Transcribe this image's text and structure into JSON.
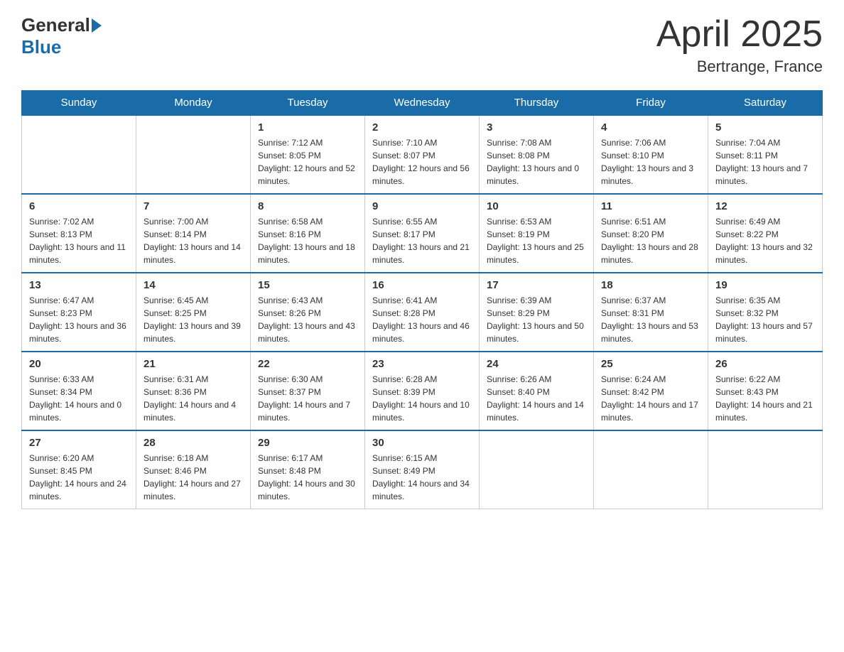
{
  "header": {
    "logo": {
      "general": "General",
      "blue": "Blue"
    },
    "title": "April 2025",
    "subtitle": "Bertrange, France"
  },
  "weekdays": [
    "Sunday",
    "Monday",
    "Tuesday",
    "Wednesday",
    "Thursday",
    "Friday",
    "Saturday"
  ],
  "weeks": [
    [
      {
        "day": "",
        "sunrise": "",
        "sunset": "",
        "daylight": ""
      },
      {
        "day": "",
        "sunrise": "",
        "sunset": "",
        "daylight": ""
      },
      {
        "day": "1",
        "sunrise": "Sunrise: 7:12 AM",
        "sunset": "Sunset: 8:05 PM",
        "daylight": "Daylight: 12 hours and 52 minutes."
      },
      {
        "day": "2",
        "sunrise": "Sunrise: 7:10 AM",
        "sunset": "Sunset: 8:07 PM",
        "daylight": "Daylight: 12 hours and 56 minutes."
      },
      {
        "day": "3",
        "sunrise": "Sunrise: 7:08 AM",
        "sunset": "Sunset: 8:08 PM",
        "daylight": "Daylight: 13 hours and 0 minutes."
      },
      {
        "day": "4",
        "sunrise": "Sunrise: 7:06 AM",
        "sunset": "Sunset: 8:10 PM",
        "daylight": "Daylight: 13 hours and 3 minutes."
      },
      {
        "day": "5",
        "sunrise": "Sunrise: 7:04 AM",
        "sunset": "Sunset: 8:11 PM",
        "daylight": "Daylight: 13 hours and 7 minutes."
      }
    ],
    [
      {
        "day": "6",
        "sunrise": "Sunrise: 7:02 AM",
        "sunset": "Sunset: 8:13 PM",
        "daylight": "Daylight: 13 hours and 11 minutes."
      },
      {
        "day": "7",
        "sunrise": "Sunrise: 7:00 AM",
        "sunset": "Sunset: 8:14 PM",
        "daylight": "Daylight: 13 hours and 14 minutes."
      },
      {
        "day": "8",
        "sunrise": "Sunrise: 6:58 AM",
        "sunset": "Sunset: 8:16 PM",
        "daylight": "Daylight: 13 hours and 18 minutes."
      },
      {
        "day": "9",
        "sunrise": "Sunrise: 6:55 AM",
        "sunset": "Sunset: 8:17 PM",
        "daylight": "Daylight: 13 hours and 21 minutes."
      },
      {
        "day": "10",
        "sunrise": "Sunrise: 6:53 AM",
        "sunset": "Sunset: 8:19 PM",
        "daylight": "Daylight: 13 hours and 25 minutes."
      },
      {
        "day": "11",
        "sunrise": "Sunrise: 6:51 AM",
        "sunset": "Sunset: 8:20 PM",
        "daylight": "Daylight: 13 hours and 28 minutes."
      },
      {
        "day": "12",
        "sunrise": "Sunrise: 6:49 AM",
        "sunset": "Sunset: 8:22 PM",
        "daylight": "Daylight: 13 hours and 32 minutes."
      }
    ],
    [
      {
        "day": "13",
        "sunrise": "Sunrise: 6:47 AM",
        "sunset": "Sunset: 8:23 PM",
        "daylight": "Daylight: 13 hours and 36 minutes."
      },
      {
        "day": "14",
        "sunrise": "Sunrise: 6:45 AM",
        "sunset": "Sunset: 8:25 PM",
        "daylight": "Daylight: 13 hours and 39 minutes."
      },
      {
        "day": "15",
        "sunrise": "Sunrise: 6:43 AM",
        "sunset": "Sunset: 8:26 PM",
        "daylight": "Daylight: 13 hours and 43 minutes."
      },
      {
        "day": "16",
        "sunrise": "Sunrise: 6:41 AM",
        "sunset": "Sunset: 8:28 PM",
        "daylight": "Daylight: 13 hours and 46 minutes."
      },
      {
        "day": "17",
        "sunrise": "Sunrise: 6:39 AM",
        "sunset": "Sunset: 8:29 PM",
        "daylight": "Daylight: 13 hours and 50 minutes."
      },
      {
        "day": "18",
        "sunrise": "Sunrise: 6:37 AM",
        "sunset": "Sunset: 8:31 PM",
        "daylight": "Daylight: 13 hours and 53 minutes."
      },
      {
        "day": "19",
        "sunrise": "Sunrise: 6:35 AM",
        "sunset": "Sunset: 8:32 PM",
        "daylight": "Daylight: 13 hours and 57 minutes."
      }
    ],
    [
      {
        "day": "20",
        "sunrise": "Sunrise: 6:33 AM",
        "sunset": "Sunset: 8:34 PM",
        "daylight": "Daylight: 14 hours and 0 minutes."
      },
      {
        "day": "21",
        "sunrise": "Sunrise: 6:31 AM",
        "sunset": "Sunset: 8:36 PM",
        "daylight": "Daylight: 14 hours and 4 minutes."
      },
      {
        "day": "22",
        "sunrise": "Sunrise: 6:30 AM",
        "sunset": "Sunset: 8:37 PM",
        "daylight": "Daylight: 14 hours and 7 minutes."
      },
      {
        "day": "23",
        "sunrise": "Sunrise: 6:28 AM",
        "sunset": "Sunset: 8:39 PM",
        "daylight": "Daylight: 14 hours and 10 minutes."
      },
      {
        "day": "24",
        "sunrise": "Sunrise: 6:26 AM",
        "sunset": "Sunset: 8:40 PM",
        "daylight": "Daylight: 14 hours and 14 minutes."
      },
      {
        "day": "25",
        "sunrise": "Sunrise: 6:24 AM",
        "sunset": "Sunset: 8:42 PM",
        "daylight": "Daylight: 14 hours and 17 minutes."
      },
      {
        "day": "26",
        "sunrise": "Sunrise: 6:22 AM",
        "sunset": "Sunset: 8:43 PM",
        "daylight": "Daylight: 14 hours and 21 minutes."
      }
    ],
    [
      {
        "day": "27",
        "sunrise": "Sunrise: 6:20 AM",
        "sunset": "Sunset: 8:45 PM",
        "daylight": "Daylight: 14 hours and 24 minutes."
      },
      {
        "day": "28",
        "sunrise": "Sunrise: 6:18 AM",
        "sunset": "Sunset: 8:46 PM",
        "daylight": "Daylight: 14 hours and 27 minutes."
      },
      {
        "day": "29",
        "sunrise": "Sunrise: 6:17 AM",
        "sunset": "Sunset: 8:48 PM",
        "daylight": "Daylight: 14 hours and 30 minutes."
      },
      {
        "day": "30",
        "sunrise": "Sunrise: 6:15 AM",
        "sunset": "Sunset: 8:49 PM",
        "daylight": "Daylight: 14 hours and 34 minutes."
      },
      {
        "day": "",
        "sunrise": "",
        "sunset": "",
        "daylight": ""
      },
      {
        "day": "",
        "sunrise": "",
        "sunset": "",
        "daylight": ""
      },
      {
        "day": "",
        "sunrise": "",
        "sunset": "",
        "daylight": ""
      }
    ]
  ]
}
